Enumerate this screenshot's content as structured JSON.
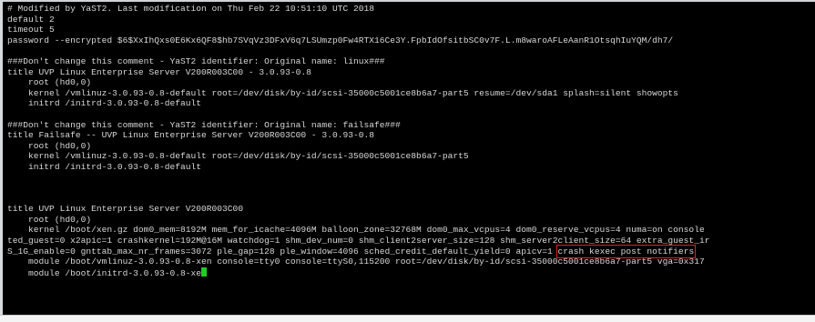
{
  "terminal": {
    "lines": [
      {
        "text": "# Modified by YaST2. Last modification on Thu Feb 22 10:51:10 UTC 2018"
      },
      {
        "text": "default 2"
      },
      {
        "text": "timeout 5"
      },
      {
        "text": "password --encrypted $6$XxIhQxs0E6Kx6QF8$hb7SVqVz3DFxV6q7LSUmzp0Fw4RTX16Ce3Y.FpbIdOfsitbSC0v7F.L.m8waroAFLeAanR1OtsqhIuYQM/dh7/"
      },
      {
        "text": ""
      },
      {
        "text": "###Don't change this comment - YaST2 identifier: Original name: linux###"
      },
      {
        "text": "title UVP Linux Enterprise Server V200R003C00 - 3.0.93-0.8"
      },
      {
        "text": "    root (hd0,0)"
      },
      {
        "text": "    kernel /vmlinuz-3.0.93-0.8-default root=/dev/disk/by-id/scsi-35000c5001ce8b6a7-part5 resume=/dev/sda1 splash=silent showopts"
      },
      {
        "text": "    initrd /initrd-3.0.93-0.8-default"
      },
      {
        "text": ""
      },
      {
        "text": "###Don't change this comment - YaST2 identifier: Original name: failsafe###"
      },
      {
        "text": "title Failsafe -- UVP Linux Enterprise Server V200R003C00 - 3.0.93-0.8"
      },
      {
        "text": "    root (hd0,0)"
      },
      {
        "text": "    kernel /vmlinuz-3.0.93-0.8-default root=/dev/disk/by-id/scsi-35000c5001ce8b6a7-part5"
      },
      {
        "text": "    initrd /initrd-3.0.93-0.8-default"
      },
      {
        "text": ""
      },
      {
        "text": ""
      },
      {
        "text": ""
      },
      {
        "text": "title UVP Linux Enterprise Server V200R003C00"
      },
      {
        "text": "    root (hd0,0)"
      },
      {
        "text": "    kernel /boot/xen.gz dom0_mem=8192M mem_for_icache=4096M balloon_zone=32768M dom0_max_vcpus=4 dom0_reserve_vcpus=4 numa=on console"
      },
      {
        "text": "ted_guest=0 x2apic=1 crashkernel=192M@16M watchdog=1 shm_dev_num=0 shm_client2server_size=128 shm_server2client_size=64 extra_guest_ir"
      },
      {
        "text": "S_1G_enable=0 gnttab_max_nr_frames=3072 ple_gap=128 ple_window=4096 sched_credit_default_yield=0 apicv=1 ",
        "highlight": "crash kexec post notifiers"
      },
      {
        "text": "    module /boot/vmlinuz-3.0.93-0.8-xen console=tty0 console=ttyS0,115200 root=/dev/disk/by-id/scsi-35000c5001ce8b6a7-part5 vga=0x317"
      },
      {
        "text": "    module /boot/initrd-3.0.93-0.8-xe",
        "cursor": true
      }
    ]
  },
  "colors": {
    "background": "#000000",
    "text": "#d8d8d8",
    "highlight_box": "#e02020",
    "cursor": "#22cc22"
  }
}
